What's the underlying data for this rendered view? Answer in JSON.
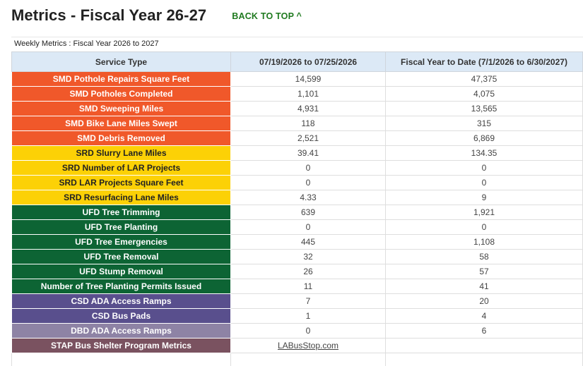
{
  "header": {
    "title": "Metrics - Fiscal Year 26-27",
    "back_to_top": "BACK TO TOP ^"
  },
  "sheet": {
    "title": "Weekly Metrics : Fiscal Year 2026 to 2027",
    "columns": [
      "Service Type",
      "07/19/2026 to 07/25/2026",
      "Fiscal Year to Date (7/1/2026 to 6/30/2027)"
    ],
    "group_colors": {
      "smd": "#f0582a",
      "srd": "#fcd106",
      "ufd": "#0d6434",
      "csd": "#594f8d",
      "dbd": "#8e83a5",
      "stap": "#7a5260"
    },
    "rows": [
      {
        "service": "SMD Pothole Repairs Square Feet",
        "week": "14,599",
        "ytd": "47,375"
      },
      {
        "service": "SMD Potholes Completed",
        "week": "1,101",
        "ytd": "4,075"
      },
      {
        "service": "SMD Sweeping Miles",
        "week": "4,931",
        "ytd": "13,565"
      },
      {
        "service": "SMD Bike Lane Miles Swept",
        "week": "118",
        "ytd": "315"
      },
      {
        "service": "SMD Debris Removed",
        "week": "2,521",
        "ytd": "6,869"
      },
      {
        "service": "SRD Slurry Lane Miles",
        "week": "39.41",
        "ytd": "134.35"
      },
      {
        "service": "SRD Number of LAR Projects",
        "week": "0",
        "ytd": "0"
      },
      {
        "service": "SRD LAR Projects Square Feet",
        "week": "0",
        "ytd": "0"
      },
      {
        "service": "SRD Resurfacing Lane Miles",
        "week": "4.33",
        "ytd": "9"
      },
      {
        "service": "UFD Tree Trimming",
        "week": "639",
        "ytd": "1,921"
      },
      {
        "service": "UFD Tree Planting",
        "week": "0",
        "ytd": "0"
      },
      {
        "service": "UFD Tree Emergencies",
        "week": "445",
        "ytd": "1,108"
      },
      {
        "service": "UFD Tree Removal",
        "week": "32",
        "ytd": "58"
      },
      {
        "service": "UFD Stump Removal",
        "week": "26",
        "ytd": "57"
      },
      {
        "service": "Number of Tree Planting Permits Issued",
        "week": "11",
        "ytd": "41"
      },
      {
        "service": "CSD ADA Access Ramps",
        "week": "7",
        "ytd": "20"
      },
      {
        "service": "CSD Bus Pads",
        "week": "1",
        "ytd": "4"
      },
      {
        "service": "DBD ADA Access Ramps",
        "week": "0",
        "ytd": "6"
      },
      {
        "service": "STAP Bus Shelter Program Metrics",
        "week": "LABusStop.com",
        "ytd": ""
      }
    ]
  }
}
